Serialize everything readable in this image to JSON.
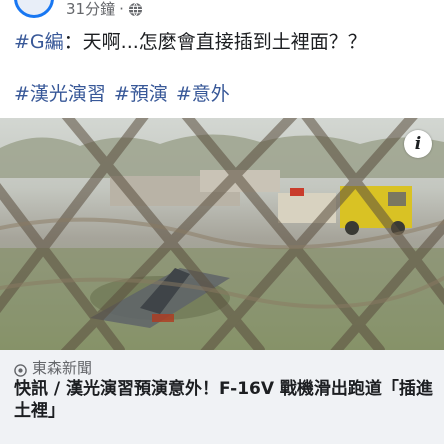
{
  "post": {
    "time_label": "31分鐘",
    "separator": "·",
    "privacy_icon": "globe-icon",
    "hashtag_prefix": "#G編",
    "text": "：天啊...怎麼會直接插到土裡面？？",
    "hashtags": [
      "#漢光演習",
      "#預演",
      "#意外"
    ]
  },
  "media": {
    "info_label": "i"
  },
  "link_card": {
    "source": "東森新聞",
    "source_icon": "location-pin-icon",
    "title": "快訊 / 漢光演習預演意外！F-16V 戰機滑出跑道「插進土裡」"
  },
  "colors": {
    "accent": "#385898",
    "meta_text": "#65676b",
    "card_bg": "#f0f2f5",
    "avatar_ring": "#1877f2"
  }
}
